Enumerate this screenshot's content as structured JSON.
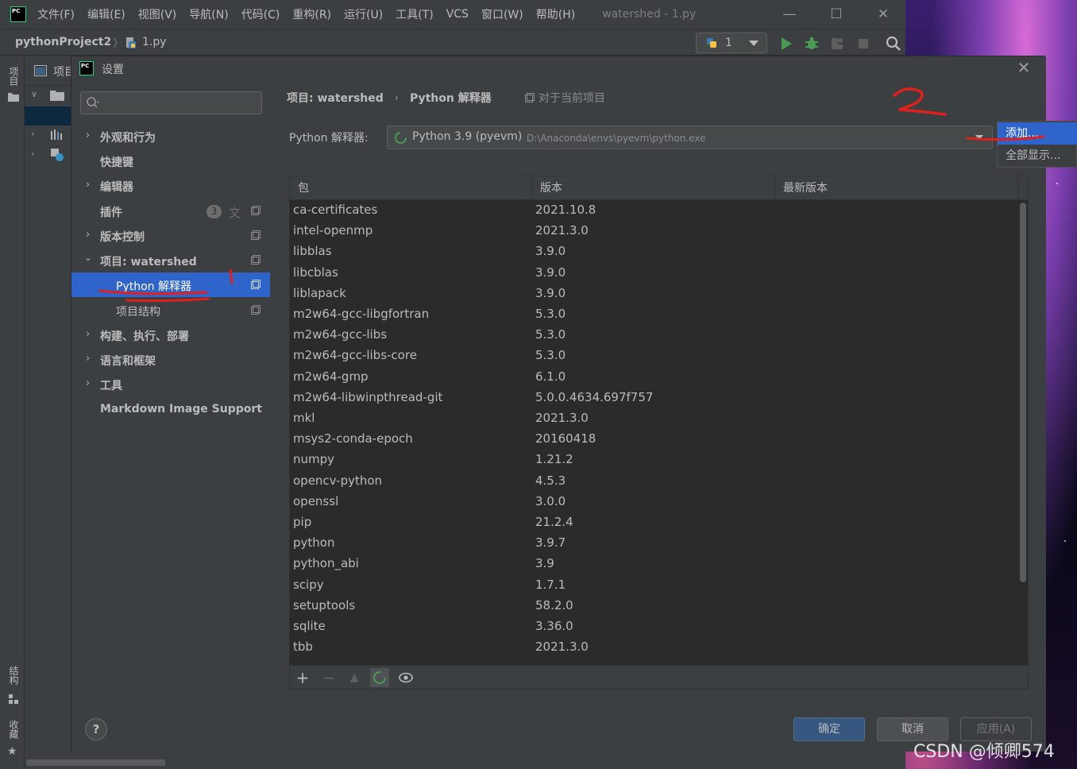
{
  "menubar": {
    "logo": "PC",
    "items": [
      "文件(F)",
      "编辑(E)",
      "视图(V)",
      "导航(N)",
      "代码(C)",
      "重构(R)",
      "运行(U)",
      "工具(T)",
      "VCS",
      "窗口(W)",
      "帮助(H)"
    ],
    "window_title": "watershed - 1.py"
  },
  "navbar": {
    "project": "pythonProject2",
    "file": "1.py",
    "run_config": "1"
  },
  "tool_strip": {
    "project_tab": "项目",
    "structure_tab": "结构",
    "favorites_tab": "收藏"
  },
  "project_panel": {
    "title": "项目"
  },
  "dialog": {
    "logo": "PC",
    "title": "设置"
  },
  "sidebar": {
    "search_placeholder": "",
    "items": [
      {
        "label": "外观和行为"
      },
      {
        "label": "快捷键"
      },
      {
        "label": "编辑器"
      },
      {
        "label": "插件",
        "badge": "3"
      },
      {
        "label": "版本控制"
      },
      {
        "label": "项目: watershed"
      },
      {
        "label": "Python 解释器"
      },
      {
        "label": "项目结构"
      },
      {
        "label": "构建、执行、部署"
      },
      {
        "label": "语言和框架"
      },
      {
        "label": "工具"
      },
      {
        "label": "Markdown Image Support"
      }
    ]
  },
  "content": {
    "breadcrumb": [
      "项目: watershed",
      "Python 解释器"
    ],
    "scope_note": "对于当前项目",
    "interpreter_label": "Python 解释器:",
    "interpreter_name": "Python 3.9 (pyevm)",
    "interpreter_path": "D:\\Anaconda\\envs\\pyevm\\python.exe"
  },
  "popup": {
    "items": [
      "添加...",
      "全部显示..."
    ]
  },
  "packages": {
    "columns": [
      "包",
      "版本",
      "最新版本"
    ],
    "rows": [
      [
        "ca-certificates",
        "2021.10.8"
      ],
      [
        "intel-openmp",
        "2021.3.0"
      ],
      [
        "libblas",
        "3.9.0"
      ],
      [
        "libcblas",
        "3.9.0"
      ],
      [
        "liblapack",
        "3.9.0"
      ],
      [
        "m2w64-gcc-libgfortran",
        "5.3.0"
      ],
      [
        "m2w64-gcc-libs",
        "5.3.0"
      ],
      [
        "m2w64-gcc-libs-core",
        "5.3.0"
      ],
      [
        "m2w64-gmp",
        "6.1.0"
      ],
      [
        "m2w64-libwinpthread-git",
        "5.0.0.4634.697f757"
      ],
      [
        "mkl",
        "2021.3.0"
      ],
      [
        "msys2-conda-epoch",
        "20160418"
      ],
      [
        "numpy",
        "1.21.2"
      ],
      [
        "opencv-python",
        "4.5.3"
      ],
      [
        "openssl",
        "3.0.0"
      ],
      [
        "pip",
        "21.2.4"
      ],
      [
        "python",
        "3.9.7"
      ],
      [
        "python_abi",
        "3.9"
      ],
      [
        "scipy",
        "1.7.1"
      ],
      [
        "setuptools",
        "58.2.0"
      ],
      [
        "sqlite",
        "3.36.0"
      ],
      [
        "tbb",
        "2021.3.0"
      ]
    ],
    "toolbar": {
      "add": "+",
      "remove": "−"
    }
  },
  "footer": {
    "help": "?",
    "ok": "确定",
    "cancel": "取消",
    "apply": "应用(A)"
  },
  "annotations": {
    "step1": "1",
    "step2": "2"
  },
  "watermark": "CSDN @倾卿574",
  "colors": {
    "accent": "#2f65ca",
    "annotation": "#e0201c",
    "ok_button": "#365880"
  }
}
